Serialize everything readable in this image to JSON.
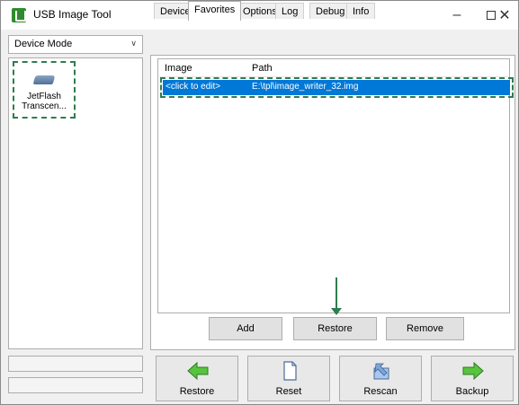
{
  "window": {
    "title": "USB Image Tool",
    "minimize": "–",
    "close": "✕"
  },
  "mode_select": {
    "value": "Device Mode",
    "chevron": "∨"
  },
  "device": {
    "line1": "JetFlash",
    "line2": "Transcen..."
  },
  "tabs": [
    {
      "label": "Device"
    },
    {
      "label": "Favorites"
    },
    {
      "label": "Options"
    },
    {
      "label": "Log"
    },
    {
      "label": "Debug"
    },
    {
      "label": "Info"
    }
  ],
  "favorites": {
    "col_image": "Image",
    "col_path": "Path",
    "row": {
      "image": "<click to edit>",
      "path": "E:\\tpl\\image_writer_32.img"
    }
  },
  "panel_buttons": {
    "add": "Add",
    "restore": "Restore",
    "remove": "Remove"
  },
  "bottom_buttons": {
    "restore": "Restore",
    "reset": "Reset",
    "rescan": "Rescan",
    "backup": "Backup"
  },
  "colors": {
    "selection": "#0078d7",
    "annotation": "#2e7d4f",
    "arrow_green": "#3fae2f"
  },
  "icons": {
    "app": "usb-tool-icon",
    "device": "usb-drive-icon",
    "restore": "left-arrow-icon",
    "reset": "document-icon",
    "rescan": "rescan-icon",
    "backup": "right-arrow-icon"
  }
}
